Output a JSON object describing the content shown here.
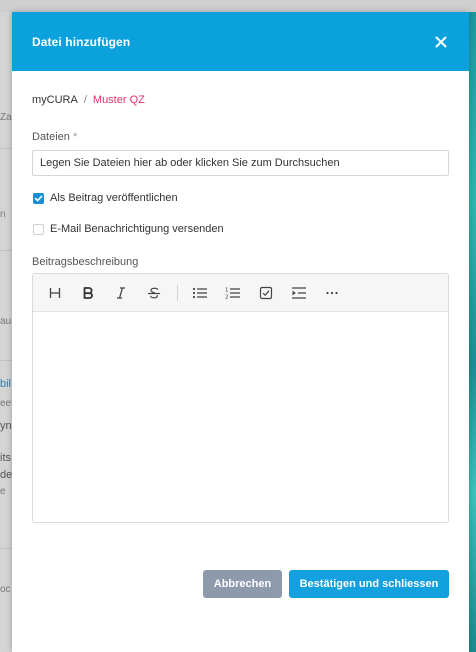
{
  "background": {
    "fragments": [
      "Za",
      "n",
      "aur",
      "bil",
      "eet",
      "yn",
      "its",
      "de",
      "e",
      "oc"
    ]
  },
  "modal": {
    "title": "Datei hinzufügen",
    "close_icon": "close-icon"
  },
  "breadcrumb": {
    "root": "myCURA",
    "separator": "/",
    "current": "Muster QZ"
  },
  "files": {
    "label": "Dateien",
    "required_marker": "*",
    "placeholder": "Legen Sie Dateien hier ab oder klicken Sie zum Durchsuchen"
  },
  "options": {
    "publish_post": {
      "label": "Als Beitrag veröffentlichen",
      "checked": true
    },
    "email_notification": {
      "label": "E-Mail Benachrichtigung versenden",
      "checked": false
    }
  },
  "description": {
    "label": "Beitragsbeschreibung",
    "toolbar": [
      "heading-icon",
      "bold-icon",
      "italic-icon",
      "strikethrough-icon",
      "bullet-list-icon",
      "numbered-list-icon",
      "task-list-icon",
      "indent-icon",
      "more-icon"
    ],
    "content": ""
  },
  "footer": {
    "cancel_label": "Abbrechen",
    "confirm_label": "Bestätigen und schliessen"
  },
  "colors": {
    "header": "#0aa1dd",
    "accent_pink": "#e0336d",
    "checkbox_checked": "#1a8fd4",
    "cancel_button": "#8d9aab",
    "confirm_button": "#12a0df"
  }
}
